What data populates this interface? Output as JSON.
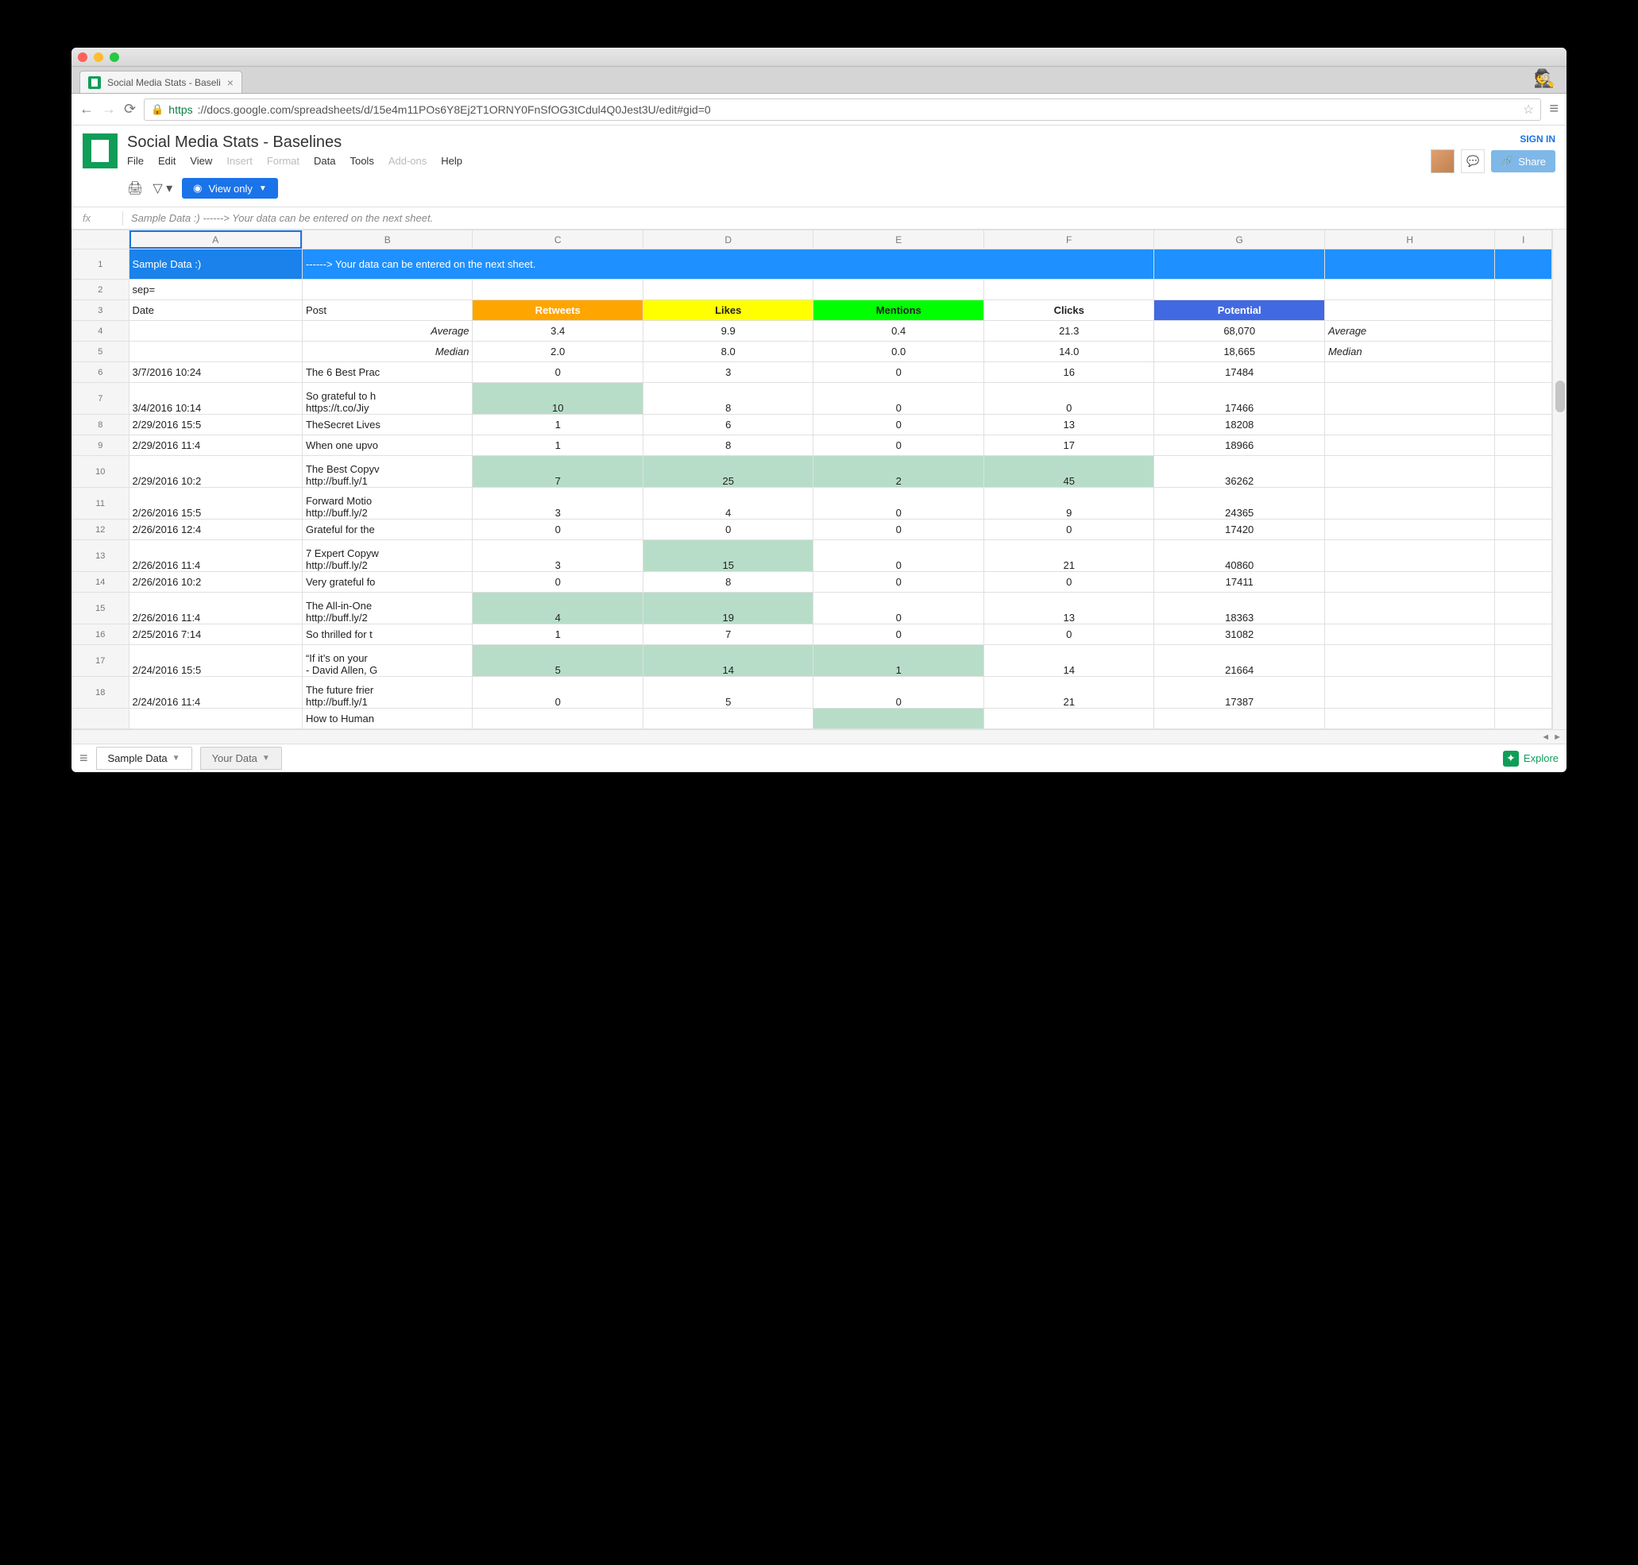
{
  "browser": {
    "tab_title": "Social Media Stats - Baseli",
    "url_scheme": "https",
    "url_rest": "://docs.google.com/spreadsheets/d/15e4m11POs6Y8Ej2T1ORNY0FnSfOG3tCdul4Q0Jest3U/edit#gid=0"
  },
  "doc": {
    "title": "Social Media Stats - Baselines",
    "sign_in": "SIGN IN",
    "share": "Share",
    "menus": [
      "File",
      "Edit",
      "View",
      "Insert",
      "Format",
      "Data",
      "Tools",
      "Add-ons",
      "Help"
    ],
    "view_only": "View only"
  },
  "fx": {
    "content": "Sample Data :)  ------> Your data can be entered on the next sheet."
  },
  "columns": [
    "A",
    "B",
    "C",
    "D",
    "E",
    "F",
    "G",
    "H",
    "I"
  ],
  "row1": {
    "a": "Sample Data :)",
    "b": "------> Your data can be entered on the next sheet."
  },
  "row2": {
    "a": "sep="
  },
  "headers": {
    "date": "Date",
    "post": "Post",
    "retweets": "Retweets",
    "likes": "Likes",
    "mentions": "Mentions",
    "clicks": "Clicks",
    "potential": "Potential"
  },
  "summary": {
    "avg_label": "Average",
    "med_label": "Median",
    "avg": {
      "retweets": "3.4",
      "likes": "9.9",
      "mentions": "0.4",
      "clicks": "21.3",
      "potential": "68,070"
    },
    "med": {
      "retweets": "2.0",
      "likes": "8.0",
      "mentions": "0.0",
      "clicks": "14.0",
      "potential": "18,665"
    }
  },
  "rows": [
    {
      "n": 6,
      "date": "3/7/2016 10:24",
      "post": "The 6 Best Prac",
      "rt": "0",
      "lk": "3",
      "mn": "0",
      "ck": "16",
      "pt": "17484",
      "hi": []
    },
    {
      "n": 7,
      "date": "3/4/2016 10:14",
      "post": "So grateful to h\nhttps://t.co/Jiy",
      "rt": "10",
      "lk": "8",
      "mn": "0",
      "ck": "0",
      "pt": "17466",
      "tall": true,
      "hi": [
        "rt"
      ]
    },
    {
      "n": 8,
      "date": "2/29/2016 15:5",
      "post": "TheSecret Lives",
      "rt": "1",
      "lk": "6",
      "mn": "0",
      "ck": "13",
      "pt": "18208",
      "hi": []
    },
    {
      "n": 9,
      "date": "2/29/2016 11:4",
      "post": "When one upvo",
      "rt": "1",
      "lk": "8",
      "mn": "0",
      "ck": "17",
      "pt": "18966",
      "hi": []
    },
    {
      "n": 10,
      "date": "2/29/2016 10:2",
      "post": "The Best Copyv\nhttp://buff.ly/1",
      "rt": "7",
      "lk": "25",
      "mn": "2",
      "ck": "45",
      "pt": "36262",
      "tall": true,
      "hi": [
        "rt",
        "lk",
        "mn",
        "ck"
      ]
    },
    {
      "n": 11,
      "date": "2/26/2016 15:5",
      "post": "Forward Motio\nhttp://buff.ly/2",
      "rt": "3",
      "lk": "4",
      "mn": "0",
      "ck": "9",
      "pt": "24365",
      "tall": true,
      "hi": []
    },
    {
      "n": 12,
      "date": "2/26/2016 12:4",
      "post": "Grateful for the",
      "rt": "0",
      "lk": "0",
      "mn": "0",
      "ck": "0",
      "pt": "17420",
      "hi": []
    },
    {
      "n": 13,
      "date": "2/26/2016 11:4",
      "post": "7 Expert Copyw\nhttp://buff.ly/2",
      "rt": "3",
      "lk": "15",
      "mn": "0",
      "ck": "21",
      "pt": "40860",
      "tall": true,
      "hi": [
        "lk"
      ]
    },
    {
      "n": 14,
      "date": "2/26/2016 10:2",
      "post": "Very grateful fo",
      "rt": "0",
      "lk": "8",
      "mn": "0",
      "ck": "0",
      "pt": "17411",
      "hi": []
    },
    {
      "n": 15,
      "date": "2/26/2016 11:4",
      "post": "The All-in-One \nhttp://buff.ly/2",
      "rt": "4",
      "lk": "19",
      "mn": "0",
      "ck": "13",
      "pt": "18363",
      "tall": true,
      "hi": [
        "rt",
        "lk"
      ]
    },
    {
      "n": 16,
      "date": "2/25/2016 7:14",
      "post": "So thrilled for t",
      "rt": "1",
      "lk": "7",
      "mn": "0",
      "ck": "0",
      "pt": "31082",
      "hi": []
    },
    {
      "n": 17,
      "date": "2/24/2016 15:5",
      "post": "“If it’s on your \n- David Allen, G",
      "rt": "5",
      "lk": "14",
      "mn": "1",
      "ck": "14",
      "pt": "21664",
      "tall": true,
      "hi": [
        "rt",
        "lk",
        "mn"
      ]
    },
    {
      "n": 18,
      "date": "2/24/2016 11:4",
      "post": "The future frier\nhttp://buff.ly/1",
      "rt": "0",
      "lk": "5",
      "mn": "0",
      "ck": "21",
      "pt": "17387",
      "tall": true,
      "hi": []
    },
    {
      "n": "",
      "date": "",
      "post": "How to Human",
      "rt": "",
      "lk": "",
      "mn": "",
      "ck": "",
      "pt": "",
      "hi": [
        "mn"
      ],
      "partial": true
    }
  ],
  "sheets": {
    "active": "Sample Data",
    "other": "Your Data"
  },
  "explore": "Explore"
}
